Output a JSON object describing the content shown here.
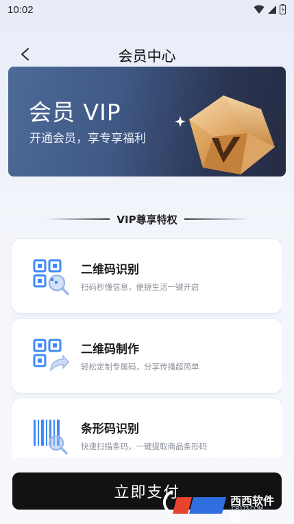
{
  "status_bar": {
    "time": "10:02",
    "icons": [
      "wifi-icon",
      "signal-icon",
      "battery-icon"
    ]
  },
  "nav": {
    "back_icon": "chevron-left-icon",
    "title": "会员中心"
  },
  "banner": {
    "title": "会员 VIP",
    "subtitle": "开通会员，享专享福利",
    "image": "gold-diamond-icon"
  },
  "section": {
    "title": "VIP尊享特权"
  },
  "features": [
    {
      "icon": "qr-scan-icon",
      "title": "二维码识别",
      "desc": "扫码秒懂信息，便捷生活一键开启"
    },
    {
      "icon": "qr-create-icon",
      "title": "二维码制作",
      "desc": "轻松定制专属码，分享传播超简单"
    },
    {
      "icon": "barcode-scan-icon",
      "title": "条形码识别",
      "desc": "快速扫描条码，一键提取商品条形码"
    }
  ],
  "pay_button": {
    "label": "立即支付"
  },
  "watermark": {
    "text": "西西软件园",
    "url": "CR173.COM"
  },
  "colors": {
    "banner_start": "#4e6a99",
    "banner_end": "#252c43",
    "accent_blue": "#3d8af7",
    "button_bg": "#121212"
  }
}
